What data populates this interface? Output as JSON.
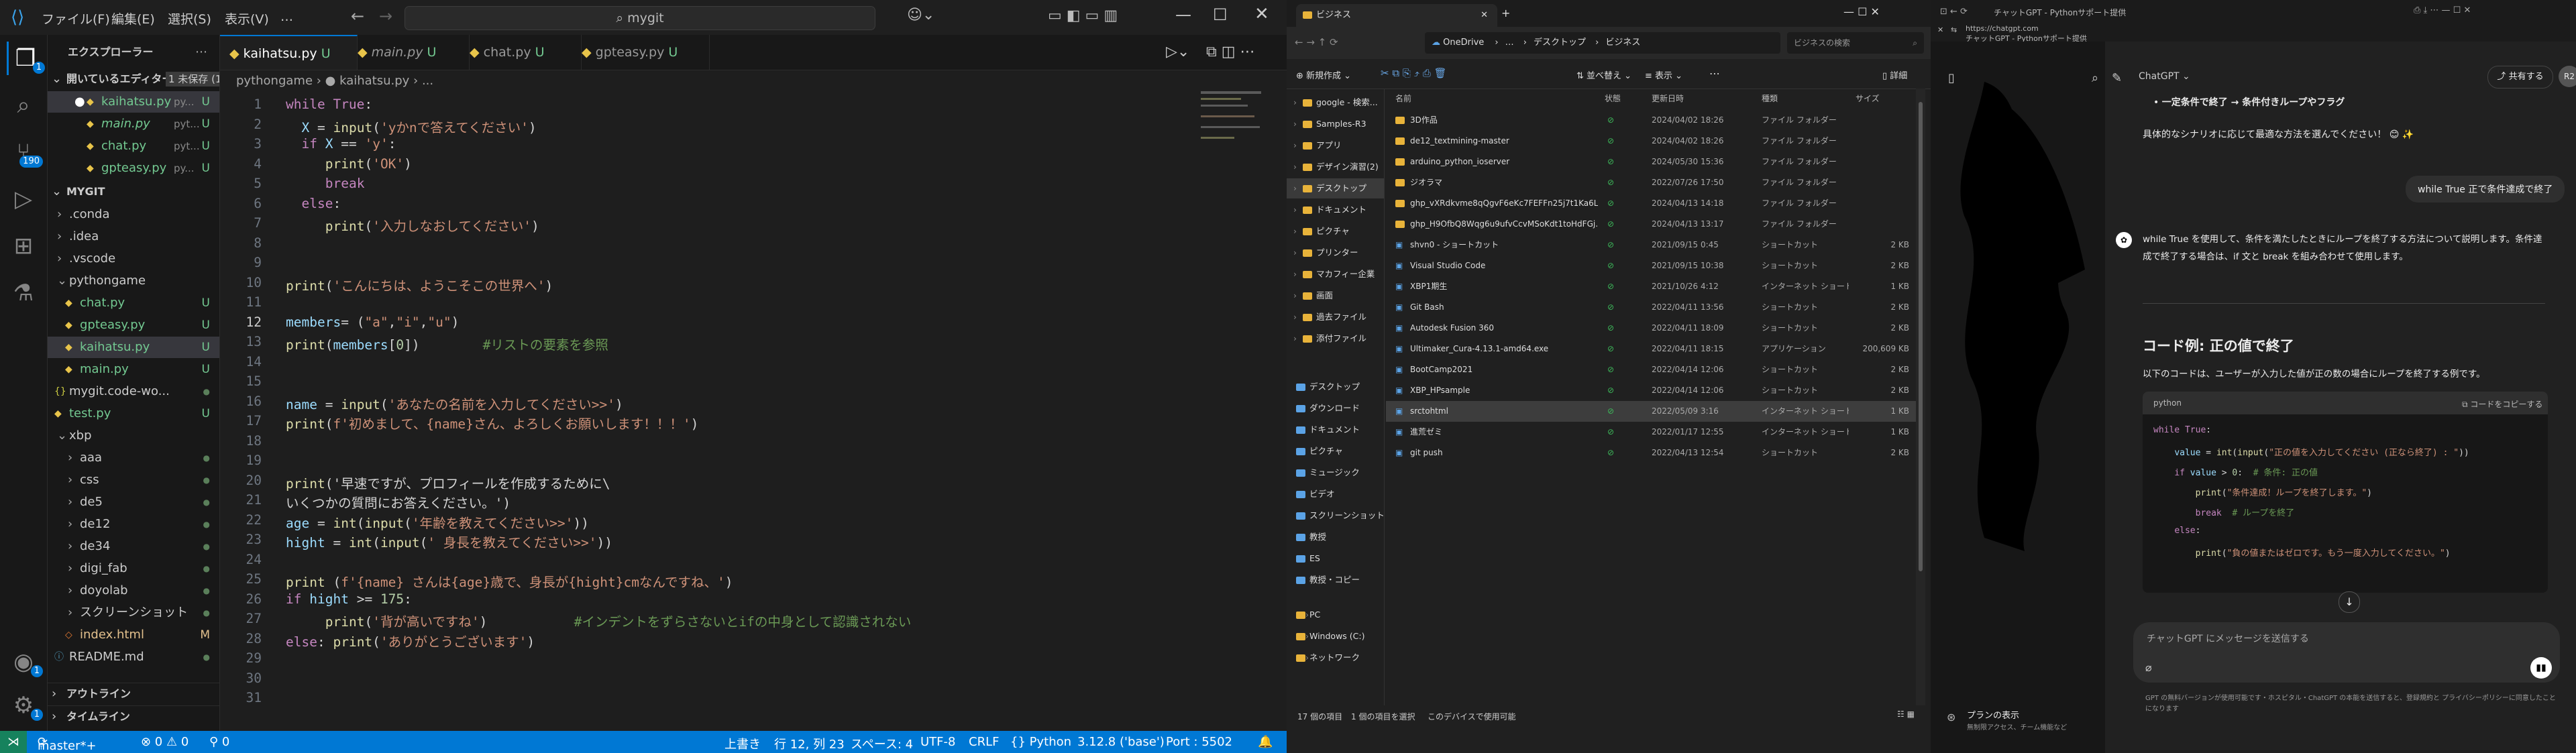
{
  "vscode": {
    "menu": [
      "ファイル(F)",
      "編集(E)",
      "選択(S)",
      "表示(V)",
      "…"
    ],
    "search": "mygit",
    "activity_badges": {
      "source_control": "190",
      "accounts": "1",
      "settings": "1"
    },
    "explorer_title": "エクスプローラー",
    "open_editors": {
      "header": "開いているエディター",
      "unsaved": "1 未保存 (1)"
    },
    "open_files": [
      {
        "name": "kaihatsu.py",
        "path": "py...",
        "mod": "U"
      },
      {
        "name": "main.py",
        "path": "pyt...",
        "mod": "U"
      },
      {
        "name": "chat.py",
        "path": "pyt...",
        "mod": "U"
      },
      {
        "name": "gpteasy.py",
        "path": "py...",
        "mod": "U"
      }
    ],
    "repo": "MYGIT",
    "tree": [
      {
        "name": ".conda",
        "indent": 1,
        "arrow": "›",
        "mod": ""
      },
      {
        "name": ".idea",
        "indent": 1,
        "arrow": "›",
        "mod": ""
      },
      {
        "name": ".vscode",
        "indent": 1,
        "arrow": "›",
        "mod": ""
      },
      {
        "name": "pythongame",
        "indent": 1,
        "arrow": "⌄",
        "mod": ""
      },
      {
        "name": "chat.py",
        "indent": 2,
        "arrow": "",
        "mod": "U"
      },
      {
        "name": "gpteasy.py",
        "indent": 2,
        "arrow": "",
        "mod": "U"
      },
      {
        "name": "kaihatsu.py",
        "indent": 2,
        "arrow": "",
        "mod": "U"
      },
      {
        "name": "main.py",
        "indent": 2,
        "arrow": "",
        "mod": "U"
      },
      {
        "name": "mygit.code-wo...",
        "indent": 1,
        "arrow": "",
        "mod": ""
      },
      {
        "name": "test.py",
        "indent": 1,
        "arrow": "",
        "mod": "U"
      },
      {
        "name": "xbp",
        "indent": 1,
        "arrow": "⌄",
        "mod": ""
      },
      {
        "name": "aaa",
        "indent": 2,
        "arrow": "›",
        "mod": ""
      },
      {
        "name": "css",
        "indent": 2,
        "arrow": "›",
        "mod": ""
      },
      {
        "name": "de5",
        "indent": 2,
        "arrow": "›",
        "mod": ""
      },
      {
        "name": "de12",
        "indent": 2,
        "arrow": "›",
        "mod": ""
      },
      {
        "name": "de34",
        "indent": 2,
        "arrow": "›",
        "mod": ""
      },
      {
        "name": "digi_fab",
        "indent": 2,
        "arrow": "›",
        "mod": ""
      },
      {
        "name": "doyolab",
        "indent": 2,
        "arrow": "›",
        "mod": ""
      },
      {
        "name": "スクリーンショット",
        "indent": 2,
        "arrow": "›",
        "mod": ""
      },
      {
        "name": "index.html",
        "indent": 2,
        "arrow": "",
        "mod": "M"
      },
      {
        "name": "README.md",
        "indent": 1,
        "arrow": "",
        "mod": ""
      }
    ],
    "outline": "アウトライン",
    "timeline": "タイムライン",
    "tabs": [
      {
        "name": "kaihatsu.py",
        "mod": "U",
        "active": true
      },
      {
        "name": "main.py",
        "mod": "U"
      },
      {
        "name": "chat.py",
        "mod": "U"
      },
      {
        "name": "gpteasy.py",
        "mod": "U"
      }
    ],
    "breadcrumb": "pythongame › ● kaihatsu.py › ...",
    "code_lines": [
      "while True:",
      "  X = input('yかnで答えてください')",
      "  if X == 'y':",
      "     print('OK')",
      "     break",
      "  else:",
      "     print('入力しなおしてください')",
      "",
      "",
      "print('こんにちは、ようこそこの世界へ')",
      "",
      "members= (\"a\",\"i\",\"u\")",
      "print(members[0])        #リストの要素を参照",
      "",
      "",
      "name = input('あなたの名前を入力してください>>')",
      "print(f'初めまして、{name}さん、よろしくお願いします！！！')",
      "",
      "",
      "print('早速ですが、プロフィールを作成するために\\",
      "いくつかの質問にお答えください。')",
      "age = int(input('年齢を教えてください>>'))",
      "hight = int(input(' 身長を教えてください>>'))",
      "",
      "print (f'{name} さんは{age}歳で、身長が{hight}cmなんですね、')",
      "if hight >= 175:",
      "     print('背が高いですね')           #インデントをずらさないとifの中身として認識されない",
      "else: print('ありがとうございます')",
      "",
      "",
      ""
    ],
    "status": {
      "branch": "master*+",
      "errors": "⊗ 0 ⚠ 0",
      "ports": "⚲ 0",
      "mode": "上書き",
      "position": "行 12, 列 23",
      "spaces": "スペース: 4",
      "encoding": "UTF-8",
      "eol": "CRLF",
      "language": "{} Python",
      "interpreter": "3.12.8 ('base')",
      "port": "Port : 5502"
    }
  },
  "explorer": {
    "tab_title": "ビジネス",
    "address": [
      "OneDrive",
      "…",
      "デスクトップ",
      "ビジネス"
    ],
    "search_placeholder": "ビジネスの検索",
    "toolbar": {
      "new": "新規作成",
      "sort": "並べ替え",
      "view": "表示",
      "details": "詳細"
    },
    "columns": [
      "名前",
      "状態",
      "更新日時",
      "種類",
      "サイズ"
    ],
    "nav_items": [
      "google - 検索...",
      "Samples-R3",
      "アプリ",
      "デザイン演習(2)",
      "デスクトップ",
      "ドキュメント",
      "ピクチャ",
      "プリンター",
      "マカフィー企業",
      "画面",
      "過去ファイル",
      "添付ファイル",
      "デスクトップ",
      "ダウンロード",
      "ドキュメント",
      "ピクチャ",
      "ミュージック",
      "ビデオ",
      "スクリーンショット",
      "教授",
      "ES",
      "教授・コピー",
      "PC",
      "Windows (C:)",
      "ネットワーク"
    ],
    "files": [
      {
        "name": "3D作品",
        "date": "2024/04/02 18:26",
        "type": "ファイル フォルダー",
        "size": ""
      },
      {
        "name": "de12_textmining-master",
        "date": "2024/04/02 18:26",
        "type": "ファイル フォルダー",
        "size": ""
      },
      {
        "name": "arduino_python_ioserver",
        "date": "2024/05/30 15:36",
        "type": "ファイル フォルダー",
        "size": ""
      },
      {
        "name": "ジオラマ",
        "date": "2022/07/26 17:50",
        "type": "ファイル フォルダー",
        "size": ""
      },
      {
        "name": "ghp_vXRdkvme8qQgvF6eKc7FEFFn25j7t1Ka6L",
        "date": "2024/04/13 14:18",
        "type": "ファイル フォルダー",
        "size": ""
      },
      {
        "name": "ghp_H9OfbQ8Wqg6u9ufvCcvMSoKdt1toHdFGj...",
        "date": "2024/04/13 13:17",
        "type": "ファイル フォルダー",
        "size": ""
      },
      {
        "name": "shvn0 - ショートカット",
        "date": "2021/09/15 0:45",
        "type": "ショートカット",
        "size": "2 KB"
      },
      {
        "name": "Visual Studio Code",
        "date": "2021/09/15 10:38",
        "type": "ショートカット",
        "size": "2 KB"
      },
      {
        "name": "XBP1期生",
        "date": "2021/10/26 4:12",
        "type": "インターネット ショートカ...",
        "size": "1 KB"
      },
      {
        "name": "Git Bash",
        "date": "2022/04/11 13:56",
        "type": "ショートカット",
        "size": "2 KB"
      },
      {
        "name": "Autodesk Fusion 360",
        "date": "2022/04/11 18:09",
        "type": "ショートカット",
        "size": "2 KB"
      },
      {
        "name": "Ultimaker_Cura-4.13.1-amd64.exe",
        "date": "2022/04/11 18:15",
        "type": "アプリケーション",
        "size": "200,609 KB"
      },
      {
        "name": "BootCamp2021",
        "date": "2022/04/14 12:06",
        "type": "ショートカット",
        "size": "2 KB"
      },
      {
        "name": "XBP_HPsample",
        "date": "2022/04/14 12:06",
        "type": "ショートカット",
        "size": "2 KB"
      },
      {
        "name": "srctohtml",
        "date": "2022/05/09 3:16",
        "type": "インターネット ショートカ...",
        "size": "1 KB"
      },
      {
        "name": "進荒ゼミ",
        "date": "2022/01/17 12:55",
        "type": "インターネット ショートカ...",
        "size": "1 KB"
      },
      {
        "name": "git push",
        "date": "2022/04/13 12:54",
        "type": "ショートカット",
        "size": "2 KB"
      }
    ],
    "status": [
      "17 個の項目",
      "1 個の項目を選択",
      "このデバイスで使用可能"
    ]
  },
  "chat": {
    "tab_title": "チャットGPT - Pythonサポート提供",
    "url": "https://chatgpt.com",
    "url_sub": "チャットGPT - Pythonサポート提供",
    "model": "ChatGPT ⌄",
    "share": "共有する",
    "avatar": "R2",
    "bullet": "一定条件で終了 → 条件付きループやフラグ",
    "closing": "具体的なシナリオに応じて最適な方法を選んでください！ 😊 ✨",
    "user_msg": "while True 正で条件達成で終了",
    "reply_intro": "while True を使用して、条件を満たしたときにループを終了する方法について説明します。条件達成で終了する場合は、if 文と break を組み合わせて使用します。",
    "heading": "コード例: 正の値で終了",
    "heading_desc": "以下のコードは、ユーザーが入力した値が正の数の場合にループを終了する例です。",
    "code_lang": "python",
    "copy_label": "コードをコピーする",
    "code": [
      "while True:",
      "    value = int(input(\"正の値を入力してください (正なら終了) : \"))",
      "    if value > 0:  # 条件: 正の値",
      "        print(\"条件達成！ループを終了します。\")",
      "        break  # ループを終了",
      "    else:",
      "        print(\"負の値またはゼロです。もう一度入力してください。\")"
    ],
    "input_placeholder": "チャットGPT にメッセージを送信する",
    "plan": "プランの表示",
    "plan_sub": "無制限アクセス、チーム機能など",
    "footer": "GPT の無料バージョンが使用可能です・ホスピタル・ChatGPT の本能を送信すると、登録規約と プライバシーポリシーに同意したことになります"
  }
}
